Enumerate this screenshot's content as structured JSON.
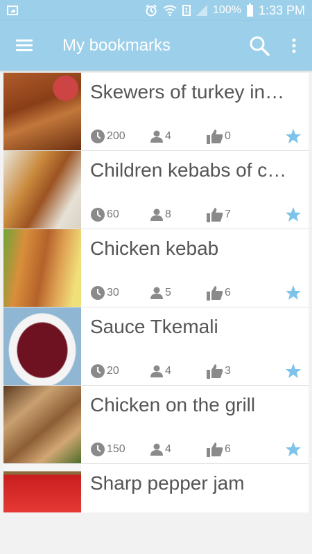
{
  "status_bar": {
    "battery_percent": "100%",
    "time": "1:33 PM",
    "sim_label": "1"
  },
  "app_bar": {
    "title": "My bookmarks"
  },
  "colors": {
    "primary": "#9ccfe9",
    "star": "#7ec4ea",
    "meta_icon": "#888888"
  },
  "icons": {
    "menu": "hamburger-icon",
    "search": "search-icon",
    "more": "more-vert-icon",
    "time": "clock-icon",
    "persons": "person-icon",
    "likes": "thumbs-up-icon",
    "bookmark": "star-icon"
  },
  "recipes": [
    {
      "title": "Skewers of turkey in…",
      "time": "200",
      "persons": "4",
      "likes": "0"
    },
    {
      "title": "Children kebabs of c…",
      "time": "60",
      "persons": "8",
      "likes": "7"
    },
    {
      "title": "Chicken kebab",
      "time": "30",
      "persons": "5",
      "likes": "6"
    },
    {
      "title": "Sauce Tkemali",
      "time": "20",
      "persons": "4",
      "likes": "3"
    },
    {
      "title": "Chicken on the grill",
      "time": "150",
      "persons": "4",
      "likes": "6"
    },
    {
      "title": "Sharp pepper jam"
    }
  ]
}
